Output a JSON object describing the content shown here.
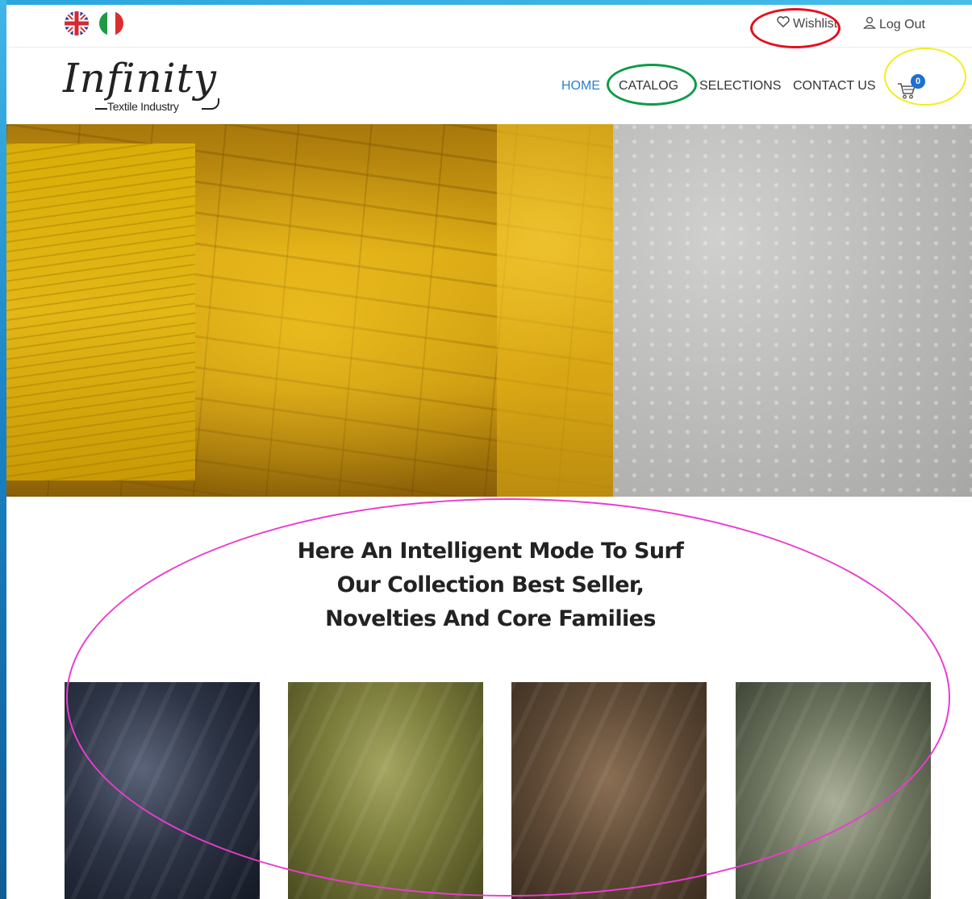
{
  "topbar": {
    "languages": [
      {
        "name": "uk-flag-icon"
      },
      {
        "name": "italy-flag-icon"
      }
    ],
    "wishlist_label": "Wishlist",
    "logout_label": "Log Out"
  },
  "header": {
    "logo_main": "Infinity",
    "logo_sub": "Textile Industry",
    "nav": {
      "home": "HOME",
      "catalog": "CATALOG",
      "selections": "SELECTIONS",
      "contact": "CONTACT US"
    },
    "cart_count": "0"
  },
  "intro": {
    "line1": "Here An Intelligent Mode To Surf",
    "line2": "Our Collection Best Seller,",
    "line3": "Novelties And Core Families"
  },
  "colors": {
    "accent": "#2b7fcf",
    "badge": "#1e6fd1",
    "annotation_red": "#e3101d",
    "annotation_green": "#0f9a49",
    "annotation_yellow": "#f2ee1d",
    "annotation_pink": "#ea3ccf"
  }
}
